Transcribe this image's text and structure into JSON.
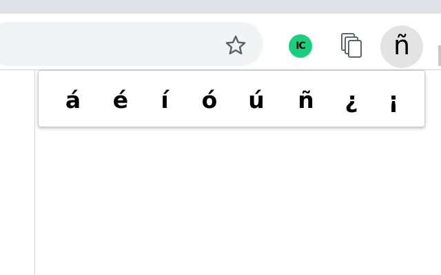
{
  "colors": {
    "tabstrip": "#dee1e6",
    "omnibox": "#f1f3f4",
    "ic_badge": "#19cf7b",
    "active_extension_bg": "#e3e3e3"
  },
  "toolbar": {
    "bookmark_icon": "star-outline-icon",
    "extensions": [
      {
        "name": "ic-extension",
        "label": "IC"
      },
      {
        "name": "copy-extension",
        "icon": "stacked-pages-icon"
      },
      {
        "name": "spanish-accents-extension",
        "label": "ñ"
      }
    ]
  },
  "popup": {
    "characters": [
      "á",
      "é",
      "í",
      "ó",
      "ú",
      "ñ",
      "¿",
      "¡"
    ]
  }
}
